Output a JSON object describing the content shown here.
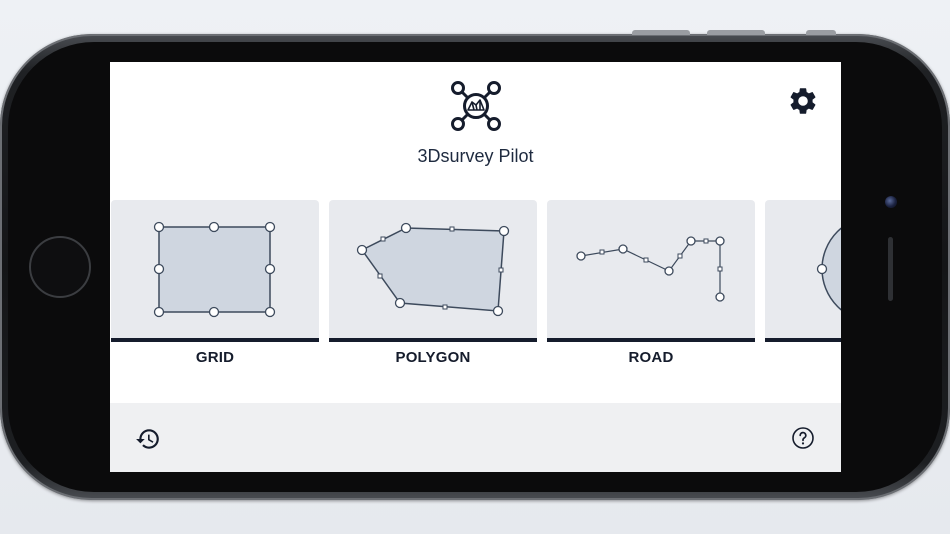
{
  "app": {
    "title": "3Dsurvey Pilot"
  },
  "icons": {
    "logo": "drone-logo-icon",
    "settings": "gear-icon",
    "history": "history-icon",
    "help": "help-icon"
  },
  "modes": [
    {
      "label": "GRID"
    },
    {
      "label": "POLYGON"
    },
    {
      "label": "ROAD"
    },
    {
      "label": ""
    }
  ],
  "colors": {
    "accent": "#151c2c",
    "card_bg": "#e8eaee",
    "shape_fill": "#cfd6e0",
    "bottom_bar": "#eff0f2"
  }
}
